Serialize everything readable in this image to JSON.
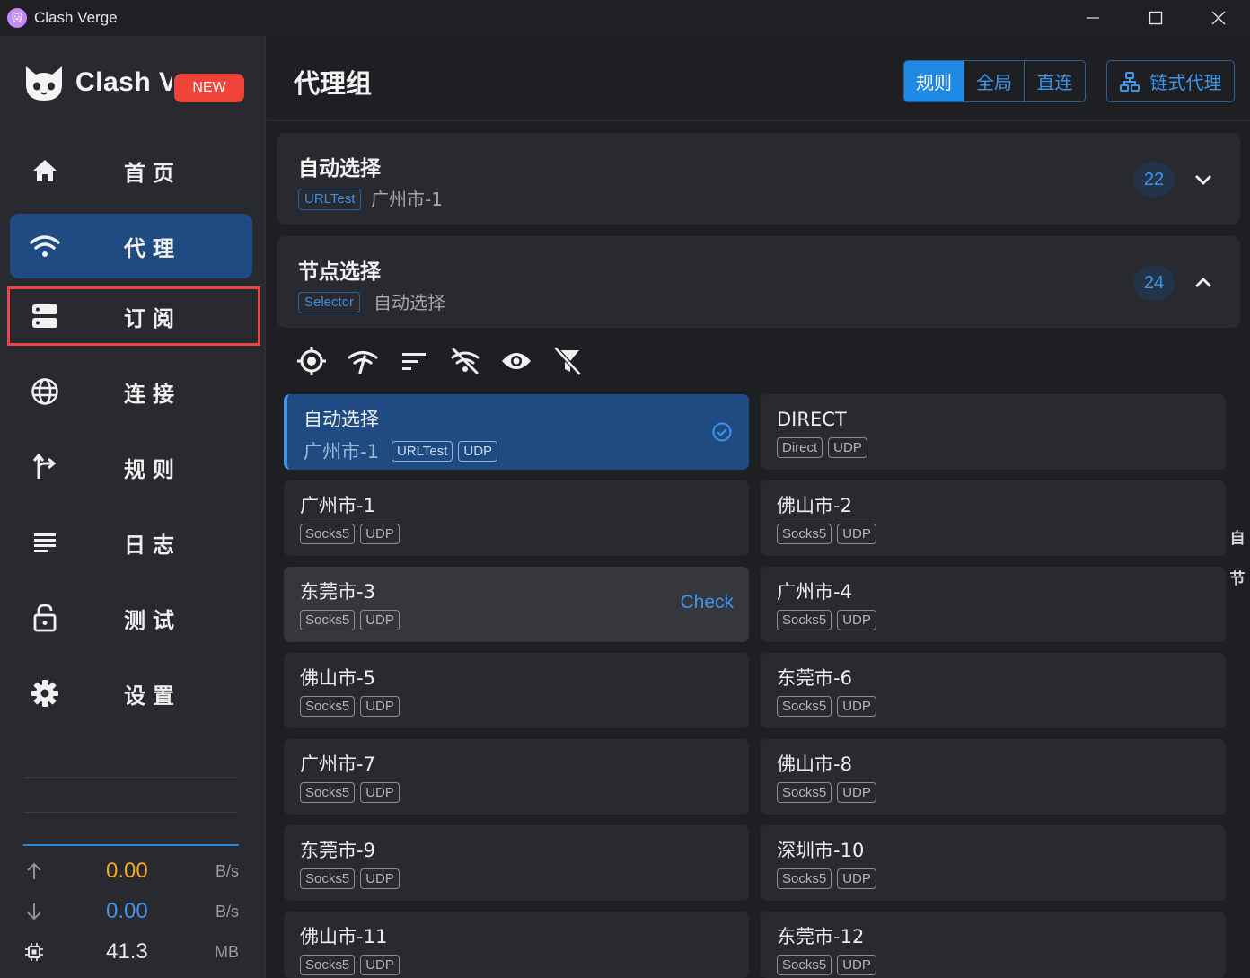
{
  "window": {
    "title": "Clash Verge",
    "logo_glyph": "🐱"
  },
  "sidebar": {
    "brand_name": "Clash Verge",
    "new_badge": "NEW",
    "items": [
      {
        "label": "首页",
        "icon": "home-icon"
      },
      {
        "label": "代理",
        "icon": "wifi-icon"
      },
      {
        "label": "订阅",
        "icon": "server-icon"
      },
      {
        "label": "连接",
        "icon": "globe-icon"
      },
      {
        "label": "规则",
        "icon": "fork-icon"
      },
      {
        "label": "日志",
        "icon": "list-icon"
      },
      {
        "label": "测试",
        "icon": "lock-icon"
      },
      {
        "label": "设置",
        "icon": "gear-icon"
      }
    ],
    "traffic": {
      "upload": {
        "value": "0.00",
        "unit": "B/s",
        "color": "#f5a623"
      },
      "download": {
        "value": "0.00",
        "unit": "B/s",
        "color": "#3f95ea"
      },
      "memory": {
        "value": "41.3",
        "unit": "MB",
        "color": "#e8e8ea"
      }
    }
  },
  "header": {
    "title": "代理组",
    "modes": [
      "规则",
      "全局",
      "直连"
    ],
    "active_mode": "规则",
    "chain_label": "链式代理"
  },
  "groups": [
    {
      "name": "自动选择",
      "type": "URLTest",
      "now": "广州市-1",
      "count": "22",
      "expanded": false
    },
    {
      "name": "节点选择",
      "type": "Selector",
      "now": "自动选择",
      "count": "24",
      "expanded": true
    }
  ],
  "toolbar": [
    "locate-icon",
    "delay-test-icon",
    "sort-icon",
    "url-test-off-icon",
    "eye-icon",
    "filter-off-icon"
  ],
  "proxies": [
    {
      "name": "自动选择",
      "now": "广州市-1",
      "tags": [
        "URLTest",
        "UDP"
      ],
      "state": "selected"
    },
    {
      "name": "DIRECT",
      "now": "",
      "tags": [
        "Direct",
        "UDP"
      ],
      "state": ""
    },
    {
      "name": "广州市-1",
      "now": "",
      "tags": [
        "Socks5",
        "UDP"
      ],
      "state": ""
    },
    {
      "name": "佛山市-2",
      "now": "",
      "tags": [
        "Socks5",
        "UDP"
      ],
      "state": ""
    },
    {
      "name": "东莞市-3",
      "now": "",
      "tags": [
        "Socks5",
        "UDP"
      ],
      "state": "hover",
      "delay": "Check"
    },
    {
      "name": "广州市-4",
      "now": "",
      "tags": [
        "Socks5",
        "UDP"
      ],
      "state": ""
    },
    {
      "name": "佛山市-5",
      "now": "",
      "tags": [
        "Socks5",
        "UDP"
      ],
      "state": ""
    },
    {
      "name": "东莞市-6",
      "now": "",
      "tags": [
        "Socks5",
        "UDP"
      ],
      "state": ""
    },
    {
      "name": "广州市-7",
      "now": "",
      "tags": [
        "Socks5",
        "UDP"
      ],
      "state": ""
    },
    {
      "name": "佛山市-8",
      "now": "",
      "tags": [
        "Socks5",
        "UDP"
      ],
      "state": ""
    },
    {
      "name": "东莞市-9",
      "now": "",
      "tags": [
        "Socks5",
        "UDP"
      ],
      "state": ""
    },
    {
      "name": "深圳市-10",
      "now": "",
      "tags": [
        "Socks5",
        "UDP"
      ],
      "state": ""
    },
    {
      "name": "佛山市-11",
      "now": "",
      "tags": [
        "Socks5",
        "UDP"
      ],
      "state": ""
    },
    {
      "name": "东莞市-12",
      "now": "",
      "tags": [
        "Socks5",
        "UDP"
      ],
      "state": ""
    }
  ],
  "side_index": [
    "自",
    "节"
  ],
  "colors": {
    "accent": "#1e88e5",
    "selected_bg": "#1f4a82",
    "highlight_border": "#e84848",
    "new_badge": "#f0433a"
  }
}
